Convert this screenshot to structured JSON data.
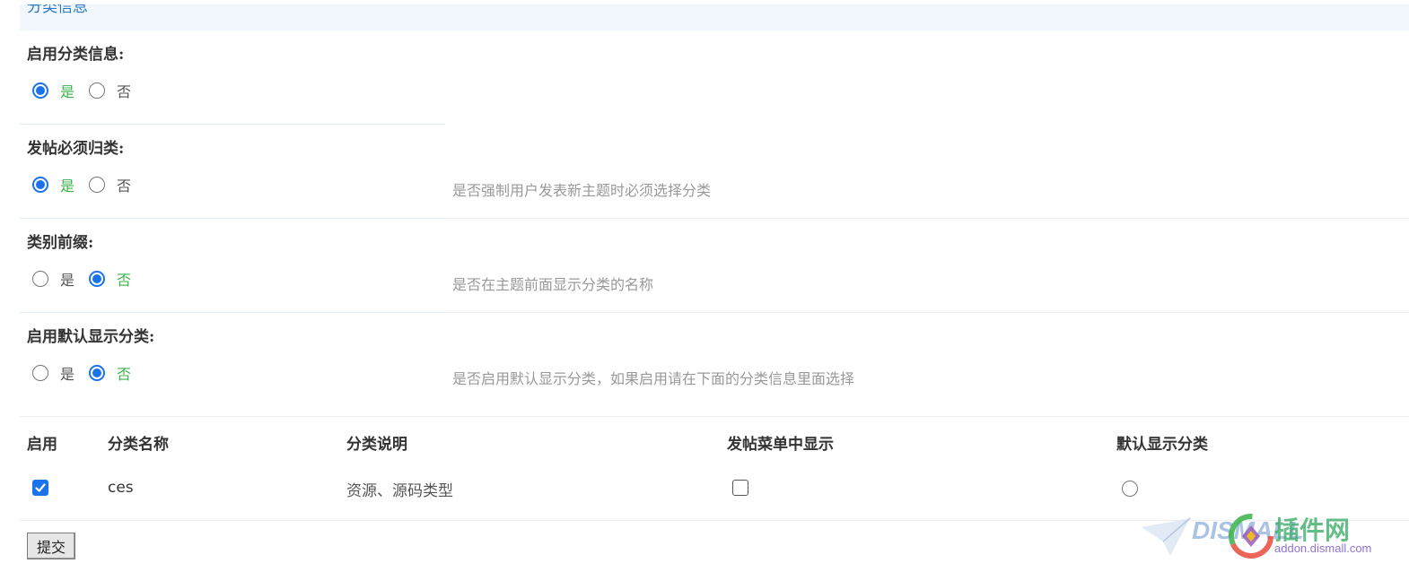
{
  "section": {
    "title": "分类信息"
  },
  "settings": [
    {
      "label": "启用分类信息:",
      "options": [
        {
          "label": "是",
          "checked": true
        },
        {
          "label": "否",
          "checked": false
        }
      ],
      "description": ""
    },
    {
      "label": "发帖必须归类:",
      "options": [
        {
          "label": "是",
          "checked": true
        },
        {
          "label": "否",
          "checked": false
        }
      ],
      "description": "是否强制用户发表新主题时必须选择分类"
    },
    {
      "label": "类别前缀:",
      "options": [
        {
          "label": "是",
          "checked": false
        },
        {
          "label": "否",
          "checked": true
        }
      ],
      "description": "是否在主题前面显示分类的名称"
    },
    {
      "label": "启用默认显示分类:",
      "options": [
        {
          "label": "是",
          "checked": false
        },
        {
          "label": "否",
          "checked": true
        }
      ],
      "description": "是否启用默认显示分类，如果启用请在下面的分类信息里面选择"
    }
  ],
  "table": {
    "headers": [
      "启用",
      "分类名称",
      "分类说明",
      "发帖菜单中显示",
      "默认显示分类"
    ],
    "rows": [
      {
        "enabled": true,
        "name": "ces",
        "description": "资源、源码类型",
        "show_in_menu": false,
        "default": false
      }
    ]
  },
  "submit": {
    "label": "提交"
  },
  "watermark": {
    "brand": "DISMALL",
    "cn": "插件网",
    "url": "addon.dismall.com"
  },
  "colors": {
    "accent": "#1a73e8",
    "active_option": "#3cb24a",
    "header_bg": "#f2f7fd",
    "header_text": "#2b79c2",
    "description": "#999999"
  }
}
